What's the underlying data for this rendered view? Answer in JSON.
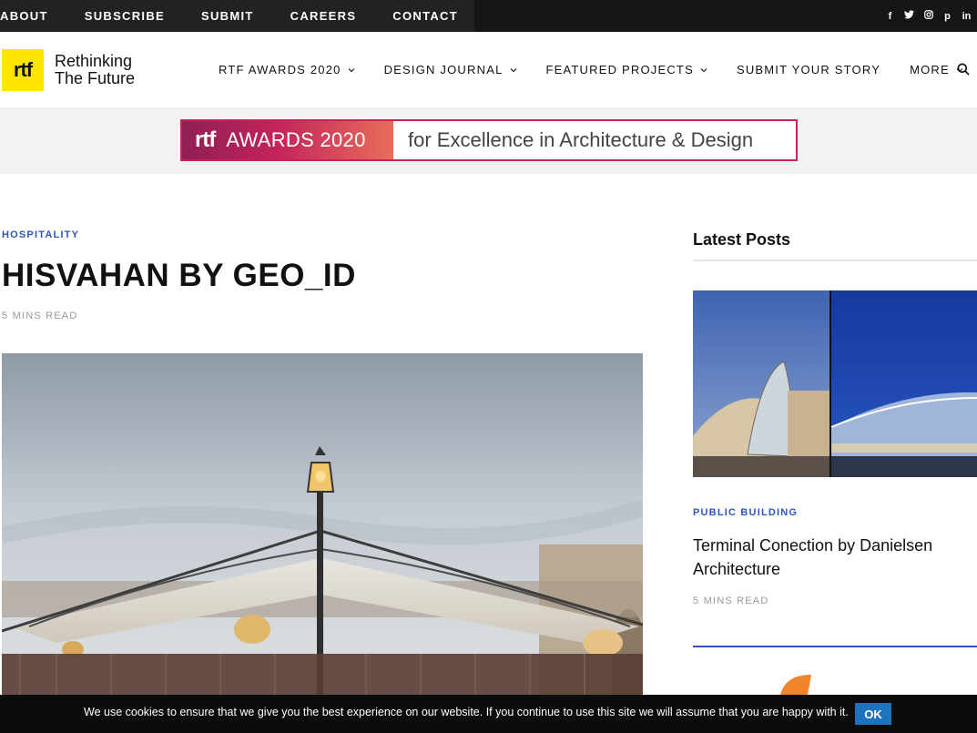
{
  "topnav": {
    "items": [
      {
        "label": "ABOUT"
      },
      {
        "label": "SUBSCRIBE"
      },
      {
        "label": "SUBMIT"
      },
      {
        "label": "CAREERS"
      },
      {
        "label": "CONTACT"
      }
    ]
  },
  "social": {
    "facebook": "f",
    "twitter": "t",
    "instagram": "◎",
    "pinterest": "p",
    "linkedin": "in"
  },
  "logo": {
    "mark": "rtf",
    "line1": "Rethinking",
    "line2": "The Future"
  },
  "mainnav": {
    "items": [
      {
        "label": "RTF AWARDS 2020"
      },
      {
        "label": "DESIGN JOURNAL"
      },
      {
        "label": "FEATURED PROJECTS"
      },
      {
        "label": "SUBMIT YOUR STORY"
      },
      {
        "label": "MORE"
      }
    ]
  },
  "banner": {
    "logo": "rtf",
    "awards": "AWARDS 2020",
    "tagline": "for Excellence in Architecture & Design"
  },
  "article": {
    "category": "HOSPITALITY",
    "title": "HISVAHAN BY GEO_ID",
    "read_time": "5 MINS READ"
  },
  "sidebar": {
    "heading": "Latest Posts",
    "post": {
      "category": "PUBLIC BUILDING",
      "title": "Terminal Conection by Danielsen Architecture",
      "read_time": "5 MINS READ"
    }
  },
  "cookie": {
    "message": "We use cookies to ensure that we give you the best experience on our website. If you continue to use this site we will assume that you are happy with it.",
    "ok_label": "OK"
  },
  "colors": {
    "accent_blue": "#2f55b8",
    "logo_yellow": "#ffe500",
    "banner_pink": "#c3245a"
  }
}
